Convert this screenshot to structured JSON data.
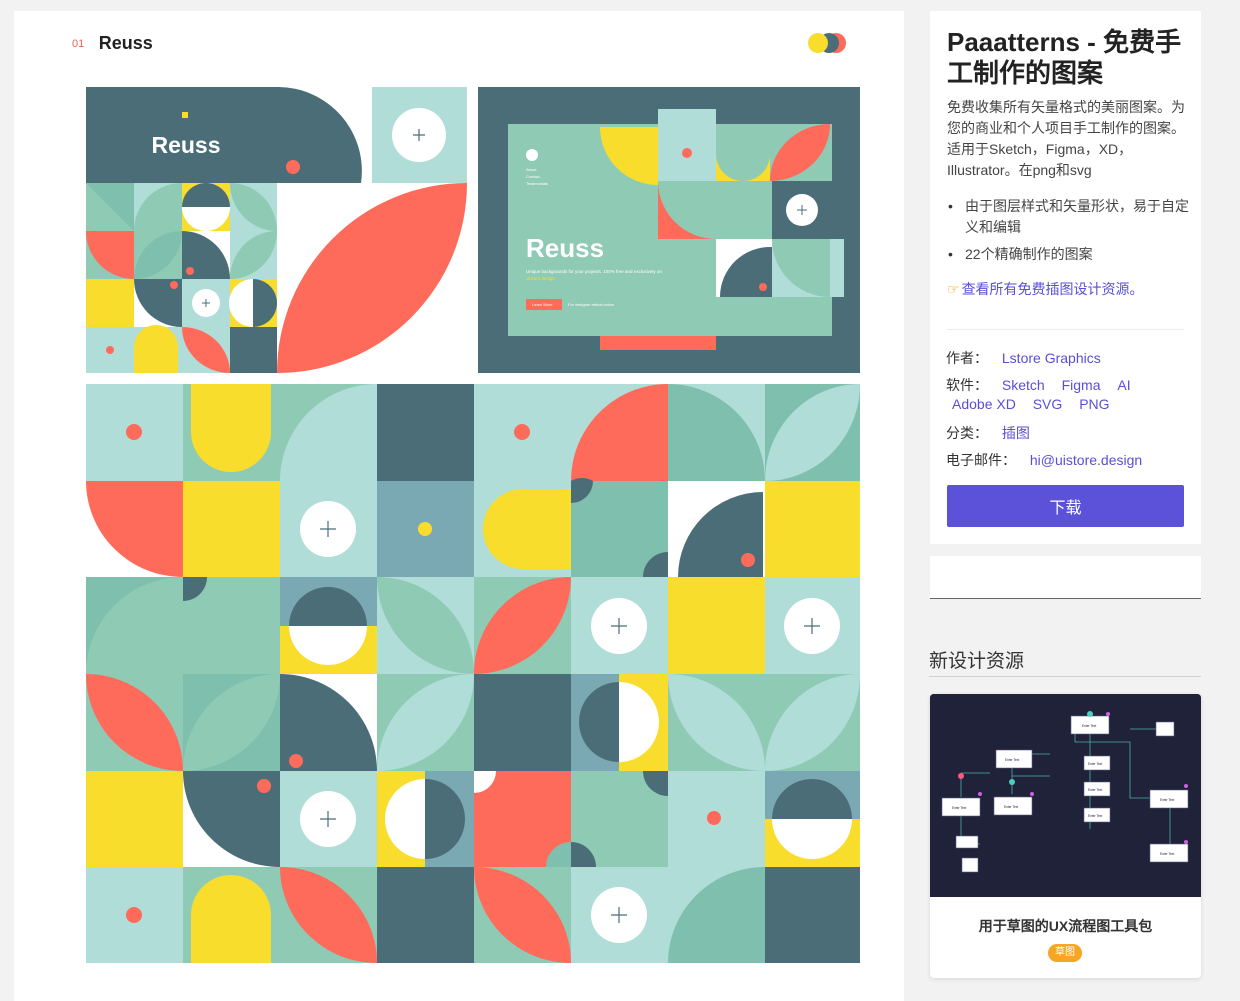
{
  "card": {
    "number": "01",
    "name": "Reuss",
    "hero": {
      "brand": "Reuss",
      "mockup_title": "Reuss",
      "mockup_nav": [
        "About",
        "Contact",
        "Testimonials"
      ],
      "mockup_tagline": "Unique backgrounds for your projects. 100% free and exclusively on",
      "mockup_tagline_accent": "Uistore.design",
      "mockup_cta": "Learn More",
      "mockup_sub": "For designer retinal colors"
    }
  },
  "colors": {
    "coral": "#ff6b5b",
    "yellow": "#f8dd2c",
    "teal_dark": "#4a6d78",
    "mint": "#8fcab5",
    "mint_light": "#b1ddd8",
    "green": "#7fbfae",
    "slate_blue": "#7aa8b3",
    "accent": "#5b52d9"
  },
  "sidebar": {
    "title": "Paaatterns - 免费手工制作的图案",
    "description": "免费收集所有矢量格式的美丽图案。为您的商业和个人项目手工制作的图案。适用于Sketch，Figma，XD，Illustrator。在png和svg",
    "bullets": [
      "由于图层样式和矢量形状，易于自定义和编辑",
      "22个精确制作的图案"
    ],
    "all_link_label": "查看所有免费插图设计资源。",
    "meta": {
      "author_label": "作者：",
      "author_value": "Lstore Graphics",
      "software_label": "软件：",
      "software_values": [
        "Sketch",
        "Figma",
        "AI",
        "Adobe XD",
        "SVG",
        "PNG"
      ],
      "category_label": "分类：",
      "category_value": "插图",
      "email_label": "电子邮件：",
      "email_value": "hi@uistore.design"
    },
    "download_label": "下载"
  },
  "new_resources": {
    "heading": "新设计资源",
    "item": {
      "name": "用于草图的UX流程图工具包",
      "badge": "草图",
      "thumb_node_label": "Enter Text"
    }
  }
}
